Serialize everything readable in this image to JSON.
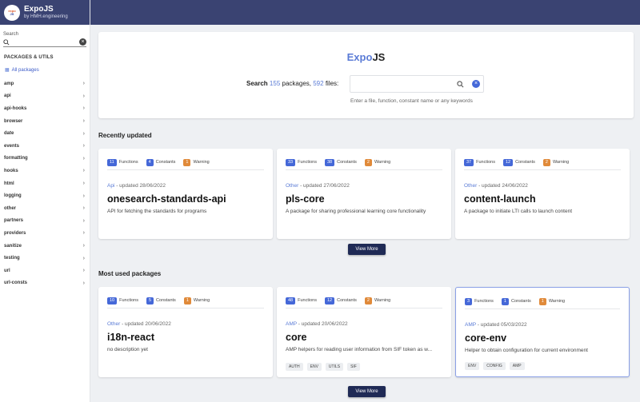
{
  "brand": {
    "title": "ExpoJS",
    "subtitle": "by HMH.engineering",
    "logo_line1": "expo",
    "logo_line2": "JS"
  },
  "sidebar": {
    "search_label": "Search",
    "search_value": "",
    "section_title": "PACKAGES & UTILS",
    "all_packages": "All packages",
    "items": [
      "amp",
      "api",
      "api-hooks",
      "browser",
      "date",
      "events",
      "formatting",
      "hooks",
      "html",
      "logging",
      "other",
      "partners",
      "providers",
      "sanitize",
      "testing",
      "url",
      "url-consts"
    ]
  },
  "hero": {
    "title_a": "Expo",
    "title_b": "JS",
    "search_word": "Search",
    "packages_count": "155",
    "packages_word": "packages,",
    "files_count": "592",
    "files_word": "files:",
    "input_value": "",
    "hint": "Enter a file, function, constant name or any keywords"
  },
  "recent": {
    "title": "Recently updated",
    "view_more": "View More",
    "cards": [
      {
        "functions": "11",
        "constants": "4",
        "warnings": "1",
        "category": "Api",
        "updated": " - updated 28/06/2022",
        "name": "onesearch-standards-api",
        "description": "API for fetching the standards for programs",
        "tags": []
      },
      {
        "functions": "33",
        "constants": "38",
        "warnings": "2",
        "category": "Other",
        "updated": " - updated 27/06/2022",
        "name": "pls-core",
        "description": "A package for sharing professional learning core functionality",
        "tags": []
      },
      {
        "functions": "37",
        "constants": "12",
        "warnings": "2",
        "category": "Other",
        "updated": " - updated 24/06/2022",
        "name": "content-launch",
        "description": "A package to initiate LTI calls to launch content",
        "tags": []
      }
    ]
  },
  "used": {
    "title": "Most used packages",
    "view_more": "View More",
    "cards": [
      {
        "functions": "10",
        "constants": "5",
        "warnings": "1",
        "category": "Other",
        "updated": " - updated 20/06/2022",
        "name": "i18n-react",
        "description": "no description yet",
        "tags": []
      },
      {
        "functions": "48",
        "constants": "12",
        "warnings": "2",
        "category": "AMP",
        "updated": " - updated 20/06/2022",
        "name": "core",
        "description": "AMP helpers for reading user information from SIF token as w...",
        "tags": [
          "AUTH",
          "ENV",
          "UTILS",
          "SIF"
        ]
      },
      {
        "functions": "3",
        "constants": "1",
        "warnings": "1",
        "category": "AMP",
        "updated": " - updated 05/03/2022",
        "name": "core-env",
        "description": "Helper to obtain configuration for current environment",
        "tags": [
          "ENV",
          "CONFIG",
          "AMP"
        ]
      }
    ]
  },
  "labels": {
    "functions": "Functions",
    "constants": "Constants",
    "warning": "Warning"
  },
  "colors": {
    "header": "#3a4372",
    "accent": "#5a7bd6",
    "badge_blue": "#4568d8",
    "badge_orange": "#e08a3a",
    "button": "#1f2a55"
  }
}
